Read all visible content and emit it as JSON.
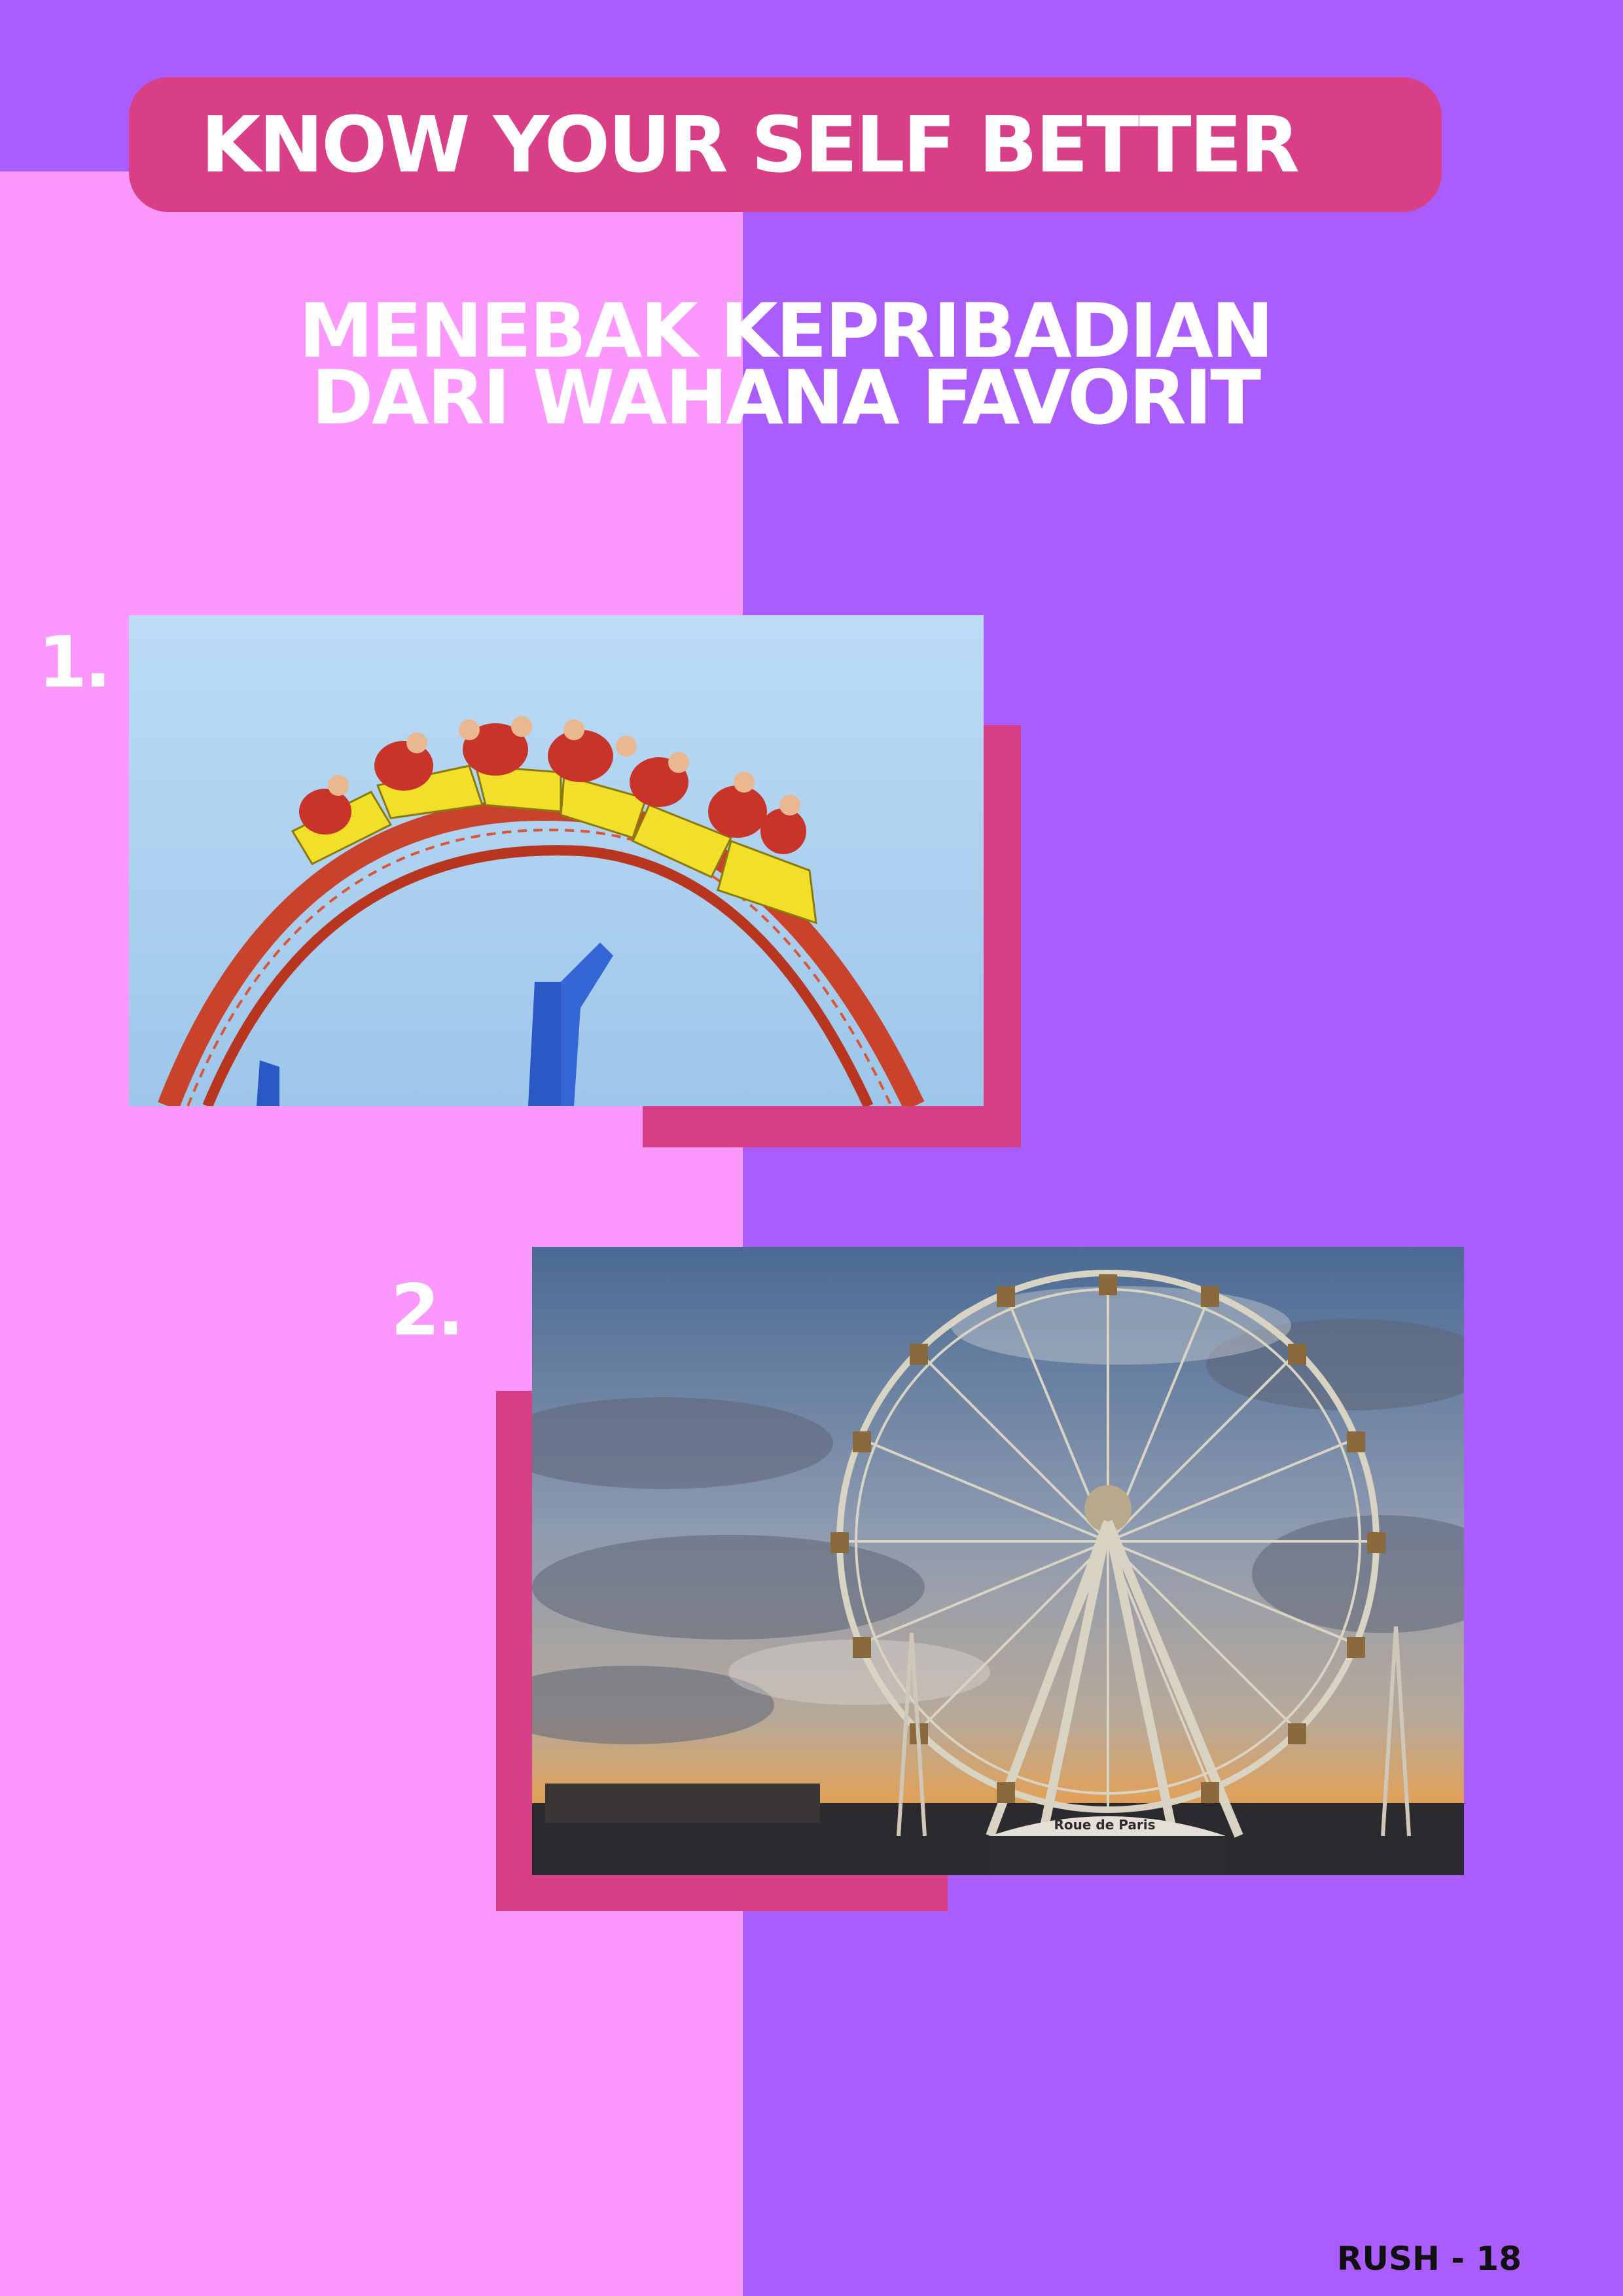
{
  "header": {
    "title": "KNOW YOUR SELF BETTER"
  },
  "subtitle": {
    "line1": "MENEBAK KEPRIBADIAN",
    "line2": "DARI WAHANA FAVORIT"
  },
  "items": [
    {
      "number": "1.",
      "photo": "roller-coaster"
    },
    {
      "number": "2.",
      "photo": "ferris-wheel",
      "sign_text": "Roue de Paris"
    }
  ],
  "footer": {
    "page_label": "RUSH - 18"
  },
  "colors": {
    "left_bg": "#fc97fd",
    "right_bg": "#ab5cfd",
    "accent": "#d93f87",
    "text_light": "#ffffff",
    "text_dark": "#111111"
  }
}
